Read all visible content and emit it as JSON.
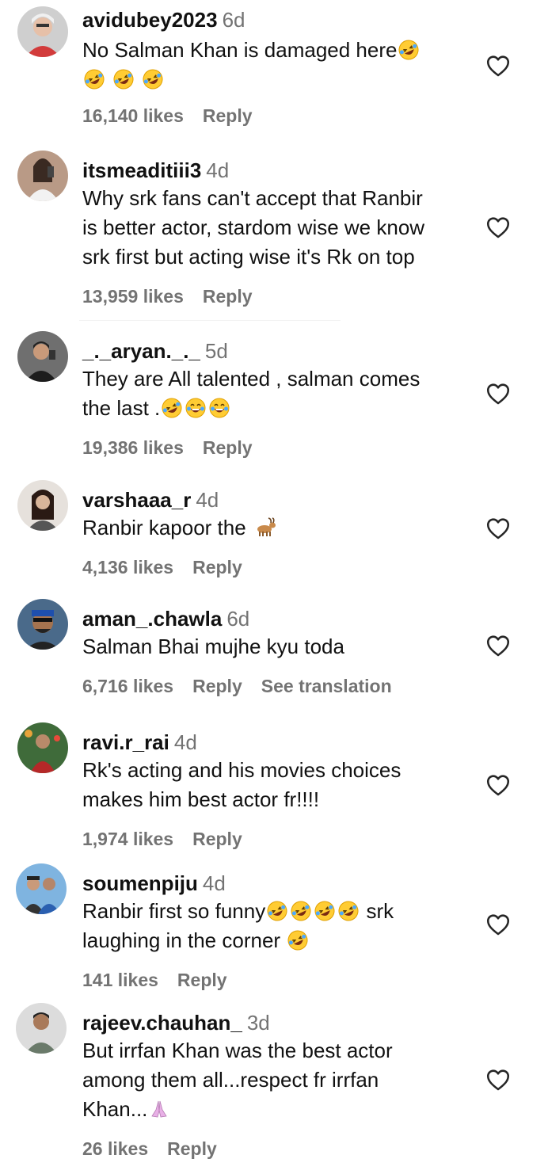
{
  "comments": [
    {
      "username": "avidubey2023",
      "time": "6d",
      "lines": [
        "No Salman Khan is damaged here",
        ""
      ],
      "emoji_after_line1": 1,
      "emoji_line2": 3,
      "likes": "16,140 likes",
      "reply": "Reply",
      "translate": ""
    },
    {
      "username": "itsmeaditiii3",
      "time": "4d",
      "lines": [
        "Why srk fans can't accept that Ranbir",
        "is better actor, stardom wise we know",
        "srk first but acting wise it's Rk on top"
      ],
      "likes": "13,959 likes",
      "reply": "Reply",
      "translate": ""
    },
    {
      "username": "__._aryan._._",
      "display_username": "_._aryan._._",
      "time": "5d",
      "lines": [
        "They are All talented , salman comes",
        "the last ."
      ],
      "likes": "19,386 likes",
      "reply": "Reply",
      "translate": ""
    },
    {
      "username": "varshaaa_r",
      "time": "4d",
      "lines": [
        "Ranbir kapoor the "
      ],
      "likes": "4,136 likes",
      "reply": "Reply",
      "translate": ""
    },
    {
      "username": "aman_.chawla",
      "time": "6d",
      "lines": [
        "Salman Bhai mujhe kyu toda"
      ],
      "likes": "6,716 likes",
      "reply": "Reply",
      "translate": "See translation"
    },
    {
      "username": "ravi.r_rai",
      "time": "4d",
      "lines": [
        "Rk's acting and his movies choices",
        "makes him best actor fr!!!!"
      ],
      "likes": "1,974 likes",
      "reply": "Reply",
      "translate": ""
    },
    {
      "username": "soumenpiju",
      "time": "4d",
      "lines": [
        "Ranbir first so funny",
        "laughing in the corner "
      ],
      "line1_suffix": " srk",
      "likes": "141 likes",
      "reply": "Reply",
      "translate": ""
    },
    {
      "username": "rajeev.chauhan_",
      "time": "3d",
      "lines": [
        "But irrfan Khan was the best actor",
        "among them all...respect fr irrfan",
        "Khan..."
      ],
      "likes": "26 likes",
      "reply": "Reply",
      "translate": ""
    }
  ],
  "icons": {
    "like": "heart-outline-icon",
    "rofl": "rolling-on-floor-laughing-emoji",
    "joy": "tears-of-joy-emoji",
    "goat": "goat-emoji",
    "pray": "folded-hands-emoji"
  },
  "colors": {
    "text": "#111111",
    "muted": "#737373",
    "background": "#ffffff"
  }
}
